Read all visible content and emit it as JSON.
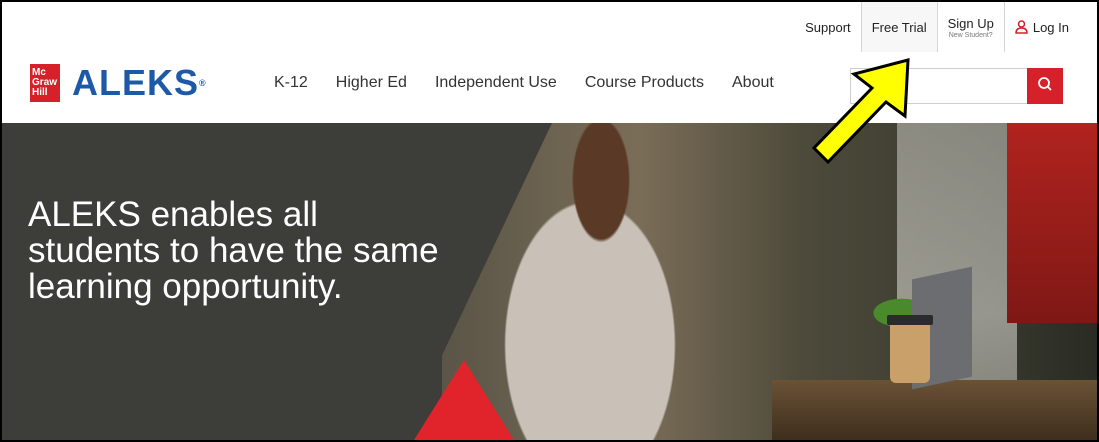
{
  "utility": {
    "support": "Support",
    "free_trial": "Free Trial",
    "sign_up": "Sign Up",
    "sign_up_sub": "New Student?",
    "log_in": "Log In"
  },
  "logo": {
    "badge_lines": [
      "Mc",
      "Graw",
      "Hill"
    ],
    "brand": "ALEKS",
    "reg": "®"
  },
  "nav": {
    "items": [
      "K-12",
      "Higher Ed",
      "Independent Use",
      "Course Products",
      "About"
    ]
  },
  "search": {
    "value": "",
    "icon": "search-icon"
  },
  "hero": {
    "headline": "ALEKS enables all students to have the same learning opportunity."
  },
  "colors": {
    "brand_red": "#d6202a",
    "brand_blue": "#1c5aa8",
    "hero_bg": "#3d3e3a",
    "annotation_yellow": "#ffff00"
  }
}
